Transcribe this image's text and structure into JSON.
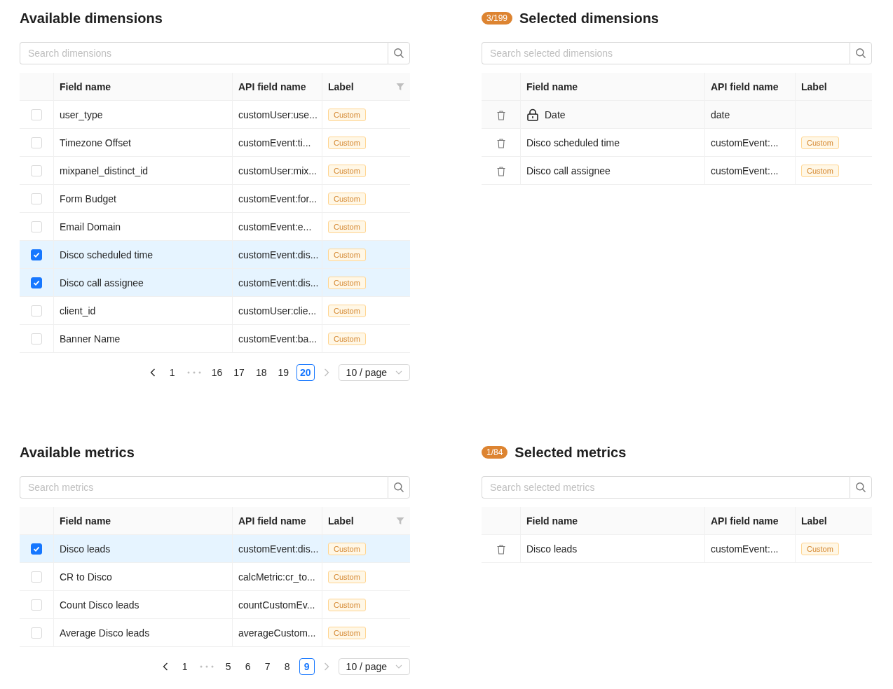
{
  "sections": [
    {
      "kind": "available",
      "title": "Available dimensions",
      "search": {
        "placeholder": "Search dimensions"
      },
      "columns": [
        {
          "title": "Field name",
          "filterable": false
        },
        {
          "title": "API field name",
          "filterable": false
        },
        {
          "title": "Label",
          "filterable": true
        }
      ],
      "rows": [
        {
          "checked": false,
          "field_name": "user_type",
          "api_field_name": "customUser:use...",
          "label": "Custom"
        },
        {
          "checked": false,
          "field_name": "Timezone Offset",
          "api_field_name": "customEvent:ti...",
          "label": "Custom"
        },
        {
          "checked": false,
          "field_name": "mixpanel_distinct_id",
          "api_field_name": "customUser:mix...",
          "label": "Custom"
        },
        {
          "checked": false,
          "field_name": "Form Budget",
          "api_field_name": "customEvent:for...",
          "label": "Custom"
        },
        {
          "checked": false,
          "field_name": "Email Domain",
          "api_field_name": "customEvent:e...",
          "label": "Custom"
        },
        {
          "checked": true,
          "field_name": "Disco scheduled time",
          "api_field_name": "customEvent:dis...",
          "label": "Custom"
        },
        {
          "checked": true,
          "field_name": "Disco call assignee",
          "api_field_name": "customEvent:dis...",
          "label": "Custom"
        },
        {
          "checked": false,
          "field_name": "client_id",
          "api_field_name": "customUser:clie...",
          "label": "Custom"
        },
        {
          "checked": false,
          "field_name": "Banner Name",
          "api_field_name": "customEvent:ba...",
          "label": "Custom"
        }
      ],
      "pagination": {
        "prev_disabled": false,
        "next_disabled": true,
        "pages": [
          {
            "label": "1",
            "selected": false
          },
          {
            "label": "16",
            "selected": false
          },
          {
            "label": "17",
            "selected": false
          },
          {
            "label": "18",
            "selected": false
          },
          {
            "label": "19",
            "selected": false
          },
          {
            "label": "20",
            "selected": true
          }
        ],
        "page_size": "10 / page"
      }
    },
    {
      "kind": "selected",
      "badge": "3/199",
      "title": "Selected dimensions",
      "search": {
        "placeholder": "Search selected dimensions"
      },
      "columns": [
        {
          "title": "Field name",
          "filterable": false
        },
        {
          "title": "API field name",
          "filterable": false
        },
        {
          "title": "Label",
          "filterable": false
        }
      ],
      "rows": [
        {
          "locked": true,
          "field_name": "Date",
          "api_field_name": "date"
        },
        {
          "locked": false,
          "field_name": "Disco scheduled time",
          "api_field_name": "customEvent:...",
          "label": "Custom"
        },
        {
          "locked": false,
          "field_name": "Disco call assignee",
          "api_field_name": "customEvent:...",
          "label": "Custom"
        }
      ]
    },
    {
      "kind": "available",
      "title": "Available metrics",
      "search": {
        "placeholder": "Search metrics"
      },
      "columns": [
        {
          "title": "Field name",
          "filterable": false
        },
        {
          "title": "API field name",
          "filterable": false
        },
        {
          "title": "Label",
          "filterable": true
        }
      ],
      "rows": [
        {
          "checked": true,
          "field_name": "Disco leads",
          "api_field_name": "customEvent:dis...",
          "label": "Custom"
        },
        {
          "checked": false,
          "field_name": "CR to Disco",
          "api_field_name": "calcMetric:cr_to...",
          "label": "Custom"
        },
        {
          "checked": false,
          "field_name": "Count Disco leads",
          "api_field_name": "countCustomEv...",
          "label": "Custom"
        },
        {
          "checked": false,
          "field_name": "Average Disco leads",
          "api_field_name": "averageCustom...",
          "label": "Custom"
        }
      ],
      "pagination": {
        "prev_disabled": false,
        "next_disabled": true,
        "pages": [
          {
            "label": "1",
            "selected": false
          },
          {
            "label": "5",
            "selected": false
          },
          {
            "label": "6",
            "selected": false
          },
          {
            "label": "7",
            "selected": false
          },
          {
            "label": "8",
            "selected": false
          },
          {
            "label": "9",
            "selected": true
          }
        ],
        "page_size": "10 / page"
      }
    },
    {
      "kind": "selected",
      "badge": "1/84",
      "title": "Selected metrics",
      "search": {
        "placeholder": "Search selected metrics"
      },
      "columns": [
        {
          "title": "Field name",
          "filterable": false
        },
        {
          "title": "API field name",
          "filterable": false
        },
        {
          "title": "Label",
          "filterable": false
        }
      ],
      "rows": [
        {
          "locked": false,
          "field_name": "Disco leads",
          "api_field_name": "customEvent:...",
          "label": "Custom"
        }
      ]
    }
  ]
}
